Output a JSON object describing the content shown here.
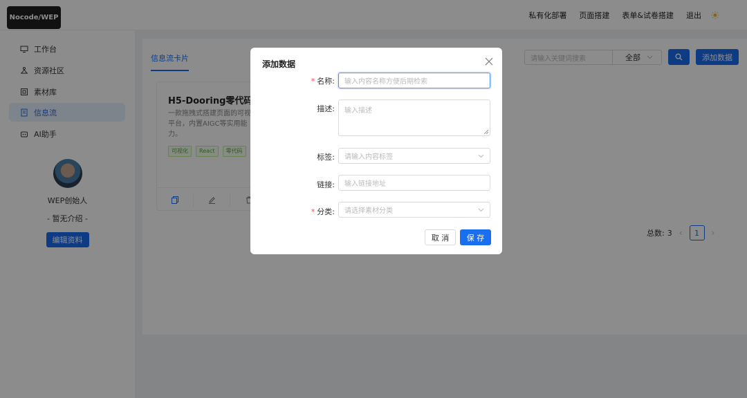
{
  "header": {
    "logo": "Nocode/WEP",
    "nav": [
      "私有化部署",
      "页面搭建",
      "表单&试卷搭建",
      "退出"
    ]
  },
  "sidebar": {
    "items": [
      {
        "label": "工作台",
        "icon": "monitor-icon"
      },
      {
        "label": "资源社区",
        "icon": "community-icon"
      },
      {
        "label": "素材库",
        "icon": "material-icon"
      },
      {
        "label": "信息流",
        "icon": "feed-icon",
        "active": true
      },
      {
        "label": "AI助手",
        "icon": "robot-icon"
      }
    ],
    "profile": {
      "name": "WEP创始人",
      "intro": "- 暂无介绍 -",
      "edit_label": "编辑资料"
    }
  },
  "main": {
    "tab": "信息流卡片",
    "search_placeholder": "请输入关键词搜索",
    "filter_value": "全部",
    "add_label": "添加数据",
    "card": {
      "title": "H5-Dooring零代码",
      "desc": "一款拖拽式搭建页面的可视化平台，内置AIGC等实用能力。",
      "tags": [
        "可视化",
        "React",
        "零代码"
      ]
    },
    "pagination": {
      "total_label": "总数:",
      "total": "3",
      "current_page": "1"
    }
  },
  "modal": {
    "title": "添加数据",
    "fields": {
      "name_label": "名称:",
      "name_placeholder": "输入内容名称方便后期检索",
      "desc_label": "描述:",
      "desc_placeholder": "输入描述",
      "tag_label": "标签:",
      "tag_placeholder": "请输入内容标签",
      "link_label": "链接:",
      "link_placeholder": "输入链接地址",
      "category_label": "分类:",
      "category_placeholder": "请选择素材分类"
    },
    "cancel_label": "取 消",
    "save_label": "保 存"
  },
  "colors": {
    "primary": "#1a6ef0",
    "required": "#ff4d4f",
    "tag_green": "#52a23a"
  }
}
